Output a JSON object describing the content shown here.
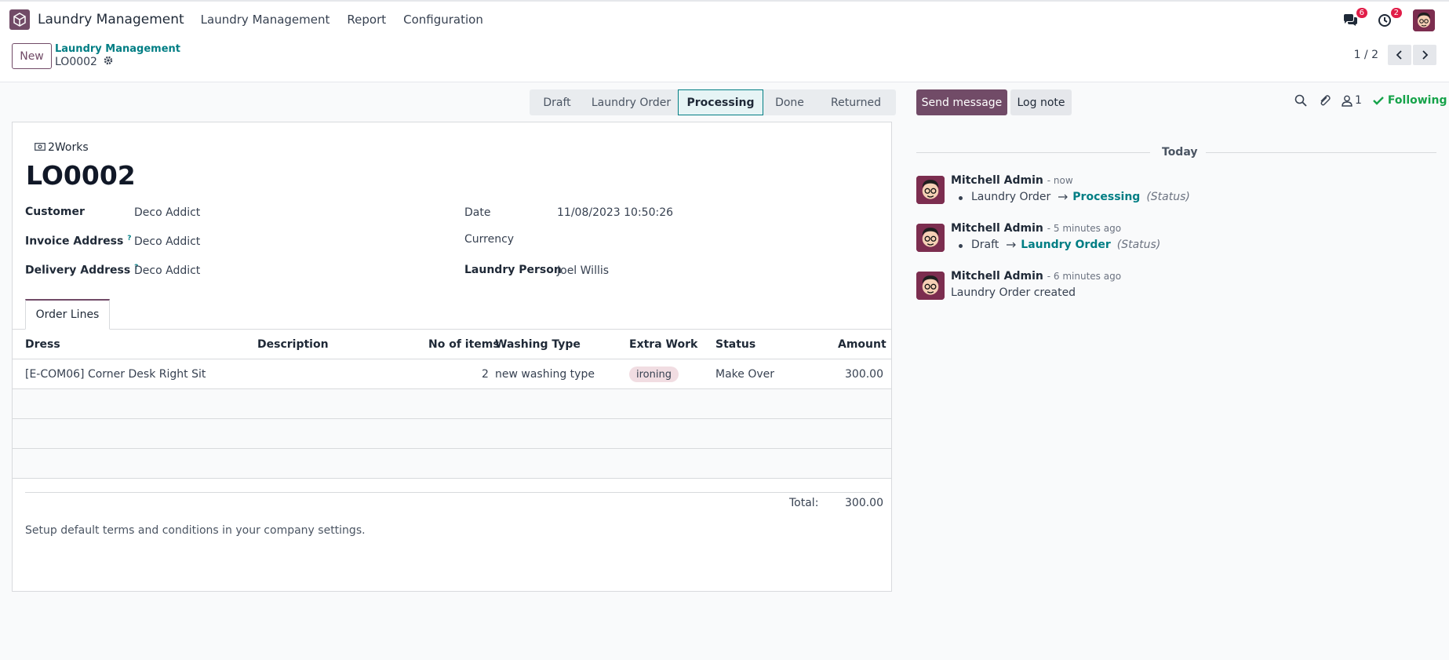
{
  "navbar": {
    "app_name": "Laundry Management",
    "menu": [
      "Laundry Management",
      "Report",
      "Configuration"
    ],
    "messages_badge": "6",
    "activities_badge": "2"
  },
  "control": {
    "new_label": "New",
    "breadcrumb_parent": "Laundry Management",
    "breadcrumb_current": "LO0002",
    "pager": "1 / 2"
  },
  "statusbar": {
    "stages": [
      "Draft",
      "Laundry Order",
      "Processing",
      "Done",
      "Returned"
    ],
    "active": "Processing"
  },
  "form": {
    "company": "2Works",
    "title": "LO0002",
    "customer_label": "Customer",
    "customer": "Deco Addict",
    "invoice_label": "Invoice Address",
    "invoice": "Deco Addict",
    "delivery_label": "Delivery Address",
    "delivery": "Deco Addict",
    "help_mark": "?",
    "date_label": "Date",
    "date": "11/08/2023 10:50:26",
    "currency_label": "Currency",
    "currency": "",
    "person_label": "Laundry Person",
    "person": "Joel Willis",
    "tab": "Order Lines",
    "columns": [
      "Dress",
      "Description",
      "No of items",
      "Washing Type",
      "Extra Work",
      "Status",
      "Amount"
    ],
    "lines": [
      {
        "dress": "[E-COM06] Corner Desk Right Sit",
        "description": "",
        "items": "2",
        "washing": "new washing type",
        "extra": "ironing",
        "status": "Make Over",
        "amount": "300.00"
      }
    ],
    "total_label": "Total:",
    "total": "300.00",
    "terms": "Setup default terms and conditions in your company settings."
  },
  "chatter": {
    "send": "Send message",
    "log": "Log note",
    "followers": "1",
    "following": "Following",
    "today": "Today",
    "messages": [
      {
        "author": "Mitchell Admin",
        "time": "- now",
        "old": "Laundry Order",
        "new": "Processing",
        "field": "(Status)"
      },
      {
        "author": "Mitchell Admin",
        "time": "- 5 minutes ago",
        "old": "Draft",
        "new": "Laundry Order",
        "field": "(Status)"
      },
      {
        "author": "Mitchell Admin",
        "time": "- 6 minutes ago",
        "text": "Laundry Order created"
      }
    ]
  },
  "colors": {
    "brand": "#714b67",
    "accent": "#017e84",
    "success": "#16a34a",
    "badge": "#e11d48"
  }
}
